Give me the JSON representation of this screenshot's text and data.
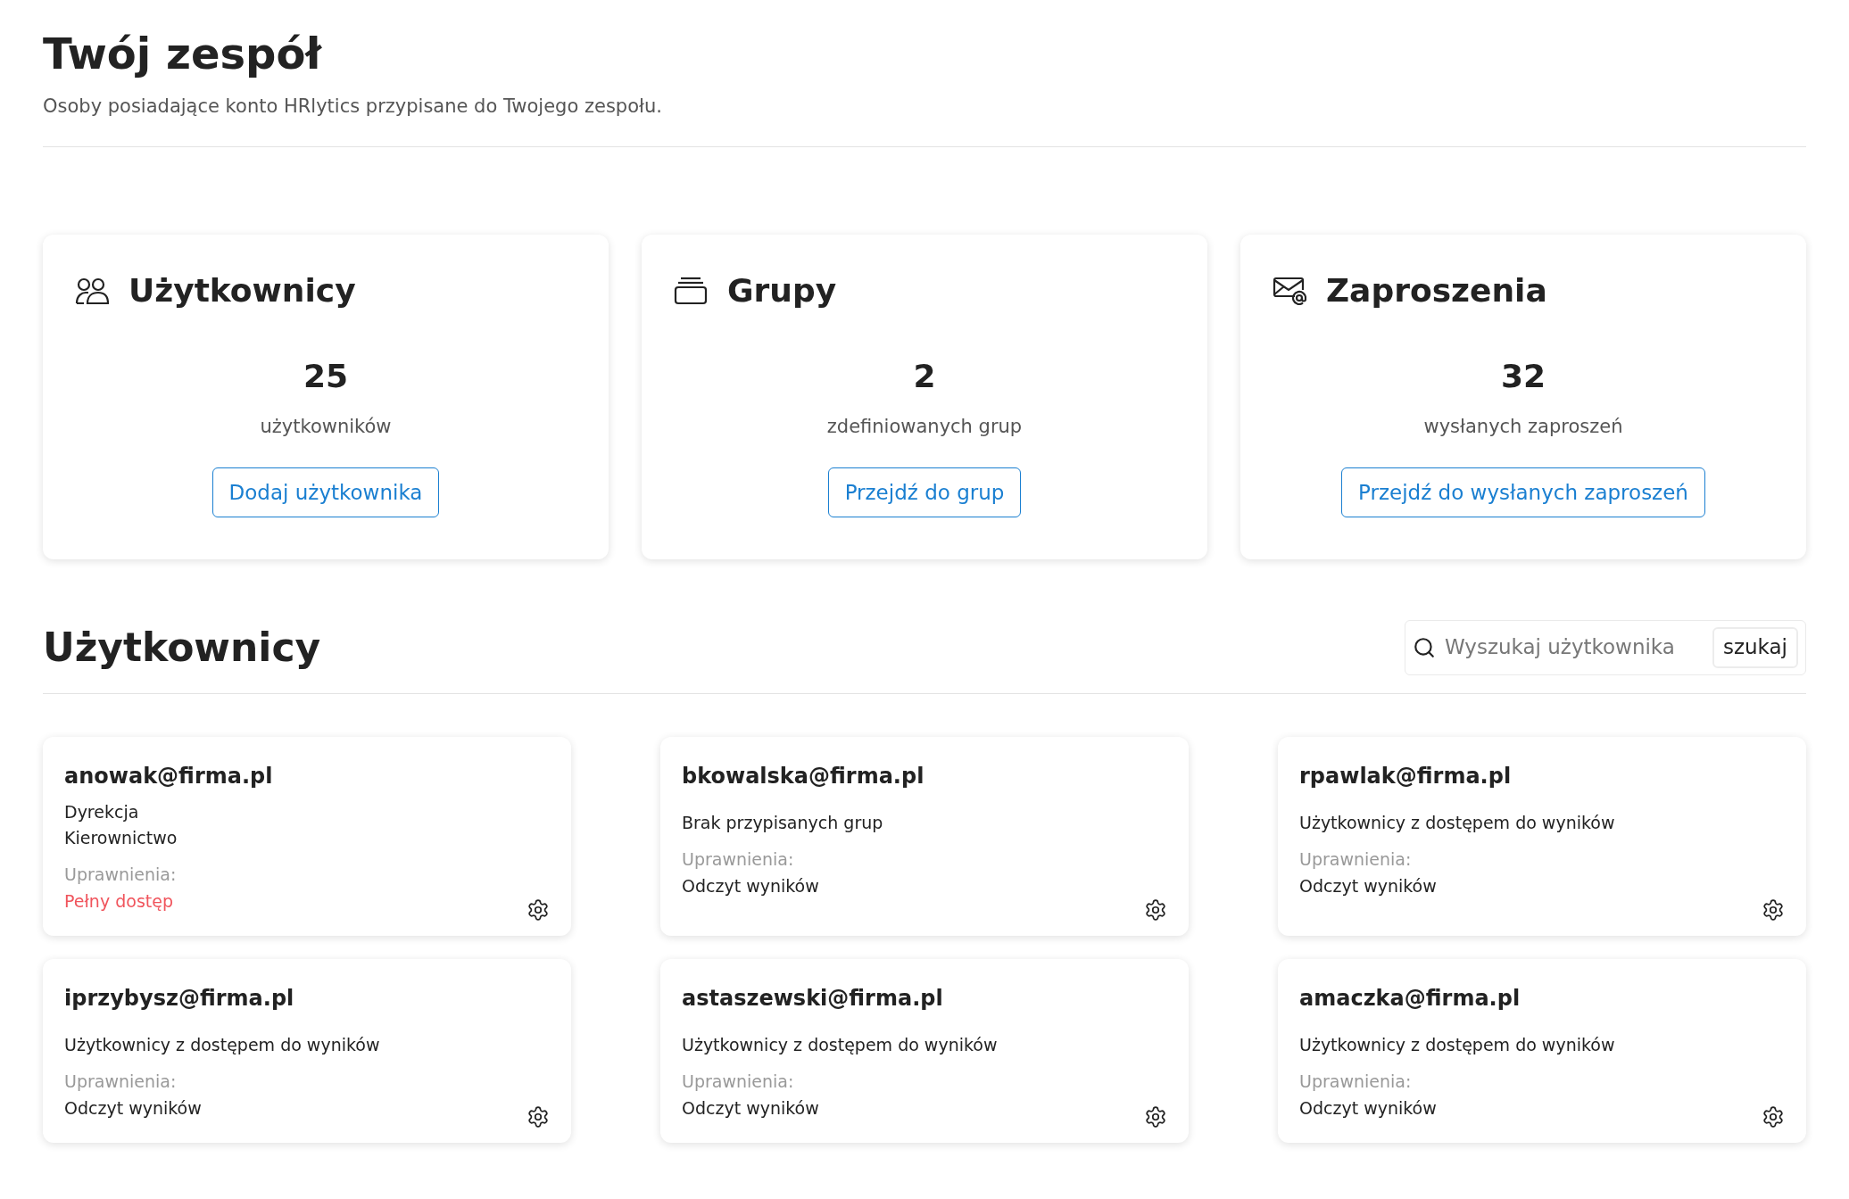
{
  "header": {
    "title": "Twój zespół",
    "subtitle": "Osoby posiadające konto HRlytics przypisane do Twojego zespołu."
  },
  "stats": [
    {
      "kind": "users",
      "title": "Użytkownicy",
      "count": "25",
      "caption": "użytkowników",
      "button": "Dodaj użytkownika"
    },
    {
      "kind": "groups",
      "title": "Grupy",
      "count": "2",
      "caption": "zdefiniowanych grup",
      "button": "Przejdź do grup"
    },
    {
      "kind": "invites",
      "title": "Zaproszenia",
      "count": "32",
      "caption": "wysłanych zaproszeń",
      "button": "Przejdź do wysłanych zaproszeń"
    }
  ],
  "users_section": {
    "title": "Użytkownicy",
    "search": {
      "placeholder": "Wyszukaj użytkownika",
      "button": "szukaj"
    }
  },
  "users": [
    {
      "email": "anowak@firma.pl",
      "groups": [
        "Dyrekcja",
        "Kierownictwo"
      ],
      "permissions_label": "Uprawnienia:",
      "permission": "Pełny dostęp",
      "kind": "full"
    },
    {
      "email": "bkowalska@firma.pl",
      "groups": [
        "Brak przypisanych grup"
      ],
      "permissions_label": "Uprawnienia:",
      "permission": "Odczyt wyników",
      "kind": "read"
    },
    {
      "email": "rpawlak@firma.pl",
      "groups": [
        "Użytkownicy z dostępem do wyników"
      ],
      "permissions_label": "Uprawnienia:",
      "permission": "Odczyt wyników",
      "kind": "read"
    },
    {
      "email": "iprzybysz@firma.pl",
      "groups": [
        "Użytkownicy z dostępem do wyników"
      ],
      "permissions_label": "Uprawnienia:",
      "permission": "Odczyt wyników",
      "kind": "read"
    },
    {
      "email": "astaszewski@firma.pl",
      "groups": [
        "Użytkownicy z dostępem do wyników"
      ],
      "permissions_label": "Uprawnienia:",
      "permission": "Odczyt wyników",
      "kind": "read"
    },
    {
      "email": "amaczka@firma.pl",
      "groups": [
        "Użytkownicy z dostępem do wyników"
      ],
      "permissions_label": "Uprawnienia:",
      "permission": "Odczyt wyników",
      "kind": "read"
    }
  ]
}
